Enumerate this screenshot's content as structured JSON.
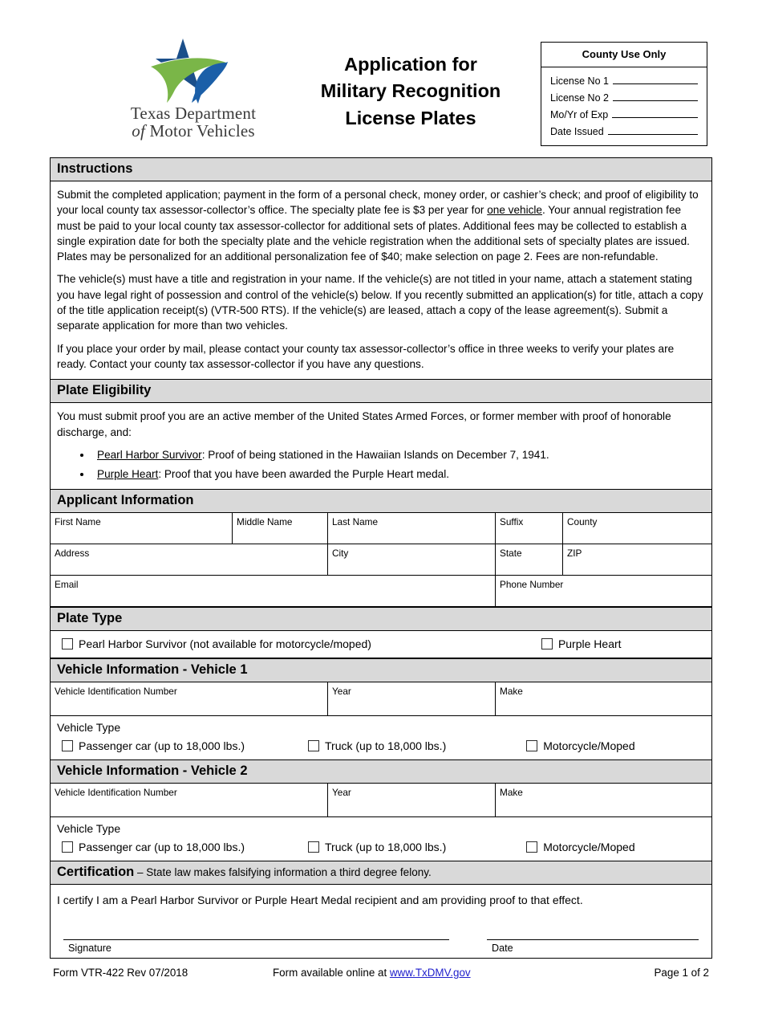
{
  "header": {
    "logo": {
      "line1_plain": "Texas ",
      "line1_rest": "Department",
      "line2_ital": "of ",
      "line2_rest": "Motor Vehicles",
      "star_blue": "#1b4f8a",
      "swoosh_green": "#7ab648",
      "swoosh_blue": "#1b5fa8"
    },
    "title_line1": "Application for",
    "title_line2": "Military Recognition",
    "title_line3": "License Plates",
    "county_box": {
      "heading": "County Use Only",
      "rows": [
        "License No 1",
        "License No 2",
        "Mo/Yr of Exp",
        "Date Issued"
      ]
    }
  },
  "instructions": {
    "heading": "Instructions",
    "p1_a": "Submit the completed application; payment in the form of a personal check, money order, or cashier’s check; and proof of eligibility to your local county tax assessor-collector’s office.  The specialty plate fee is $3 per year for ",
    "p1_underline": "one vehicle",
    "p1_b": ".  Your annual registration fee must be paid to your local county tax assessor-collector for additional sets of plates.  Additional fees may be collected to establish a single expiration date for both the specialty plate and the vehicle registration when the additional sets of specialty plates are issued. Plates may be personalized for an additional personalization fee of $40; make selection on page 2. Fees are non-refundable.",
    "p2": "The vehicle(s) must have a title and registration in your name. If the vehicle(s) are not titled in your name, attach a statement stating you have legal right of possession and control of the vehicle(s) below. If you recently submitted an application(s) for title, attach a copy of the title application receipt(s) (VTR-500 RTS). If the vehicle(s) are leased, attach a copy of the lease agreement(s). Submit a separate application for more than two vehicles.",
    "p3": "If you place your order by mail, please contact your county tax assessor-collector’s office in three weeks to verify your plates are ready.  Contact your county tax assessor-collector if you have any questions."
  },
  "eligibility": {
    "heading": "Plate Eligibility",
    "intro": "You must submit proof you are an active member of the United States Armed Forces, or former member with proof of honorable discharge, and:",
    "items": [
      {
        "term": "Pearl Harbor Survivor",
        "desc": ": Proof of being stationed in the Hawaiian Islands on December 7, 1941."
      },
      {
        "term": "Purple Heart",
        "desc": ": Proof that you have been awarded the Purple Heart medal."
      }
    ]
  },
  "applicant": {
    "heading": "Applicant Information",
    "first_name": "First Name",
    "middle_name": "Middle Name",
    "last_name": "Last Name",
    "suffix": "Suffix",
    "county": "County",
    "address": "Address",
    "city": "City",
    "state": "State",
    "zip": "ZIP",
    "email": "Email",
    "phone": "Phone Number"
  },
  "plate_type": {
    "heading": "Plate Type",
    "option_pearl": "Pearl Harbor Survivor (not available for motorcycle/moped)",
    "option_purple": "Purple Heart"
  },
  "vehicle1": {
    "heading": "Vehicle Information - Vehicle 1",
    "vin": "Vehicle Identification Number",
    "year": "Year",
    "make": "Make",
    "vehicle_type_label": "Vehicle Type",
    "type_passenger": "Passenger car (up to 18,000 lbs.)",
    "type_truck": "Truck (up to 18,000 lbs.)",
    "type_motorcycle": "Motorcycle/Moped"
  },
  "vehicle2": {
    "heading": "Vehicle Information - Vehicle 2",
    "vin": "Vehicle Identification Number",
    "year": "Year",
    "make": "Make",
    "vehicle_type_label": "Vehicle Type",
    "type_passenger": "Passenger car (up to 18,000 lbs.)",
    "type_truck": "Truck (up to 18,000 lbs.)",
    "type_motorcycle": "Motorcycle/Moped"
  },
  "certification": {
    "heading_bold": "Certification",
    "heading_rest": " – State law makes falsifying information a third degree felony.",
    "statement": "I certify I am a Pearl Harbor Survivor or Purple Heart Medal recipient and am providing proof to that effect.",
    "signature_label": "Signature",
    "date_label": "Date"
  },
  "footer": {
    "form_id": "Form VTR-422 Rev 07/2018",
    "available_prefix": "Form available online at ",
    "link_text": "www.TxDMV.gov",
    "page": "Page 1 of 2"
  }
}
